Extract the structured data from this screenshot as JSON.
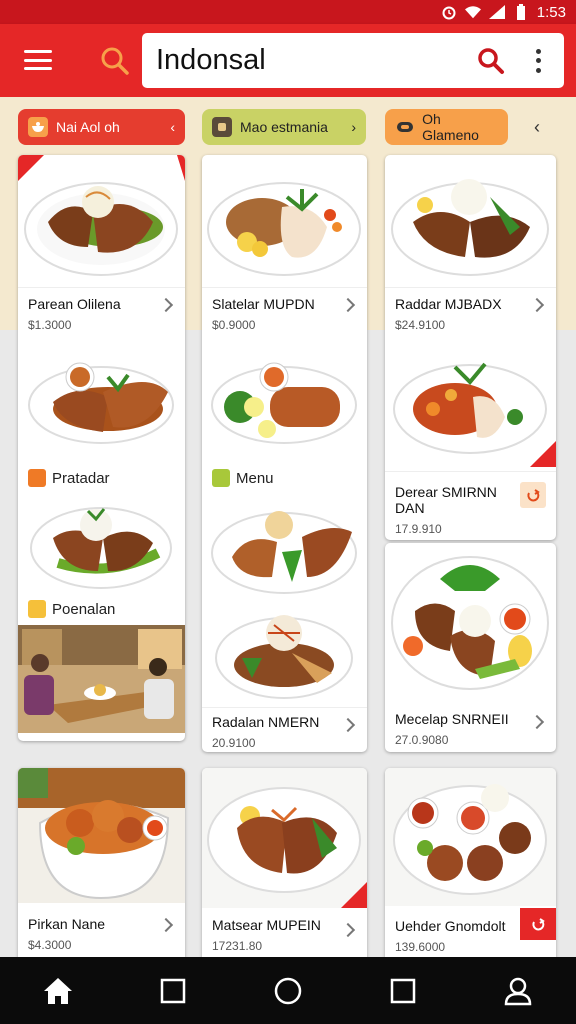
{
  "status_bar": {
    "time": "1:53"
  },
  "app_bar": {
    "title": "Indonsal"
  },
  "chips": [
    {
      "label": "Nai Aol oh",
      "color": "#e53d2f"
    },
    {
      "label": "Mao estmania",
      "color": "#c9d265"
    },
    {
      "label": "Oh Glameno",
      "color": "#f7a04a"
    }
  ],
  "column1": {
    "card1": {
      "name": "Parean Olilena",
      "price": "$1.3000"
    },
    "section_label_1": "Pratadar",
    "section_label_2": "Poenalan",
    "card_bottom": {
      "name": "Pirkan Nane",
      "price": "$4.3000"
    }
  },
  "column2": {
    "card1": {
      "name": "Slatelar MUPDN",
      "price": "$0.9000"
    },
    "section_label": "Menu",
    "card2": {
      "name": "Radalan NMERN",
      "price": "20.9100"
    },
    "card_bottom": {
      "name": "Matsear MUPEIN",
      "price": "17231.80"
    }
  },
  "column3": {
    "card1": {
      "name": "Raddar MJBADX",
      "price": "$24.9100"
    },
    "card2": {
      "name_line1": "Derear SMIRNN",
      "name_line2": "DAN",
      "price": "17.9.910"
    },
    "card3": {
      "name": "Mecelap SNRNEII",
      "price": "27.0.9080"
    },
    "card_bottom": {
      "name": "Uehder Gnomdolt",
      "price": "139.6000"
    }
  },
  "colors": {
    "brand_red": "#e52727",
    "status_red": "#c8161d",
    "cream": "#f4e9cf",
    "nav_black": "#0b0b0b"
  },
  "icons": [
    "menu-icon",
    "search-icon",
    "more-vert-icon",
    "home-icon",
    "square-icon",
    "circle-icon",
    "profile-icon"
  ]
}
